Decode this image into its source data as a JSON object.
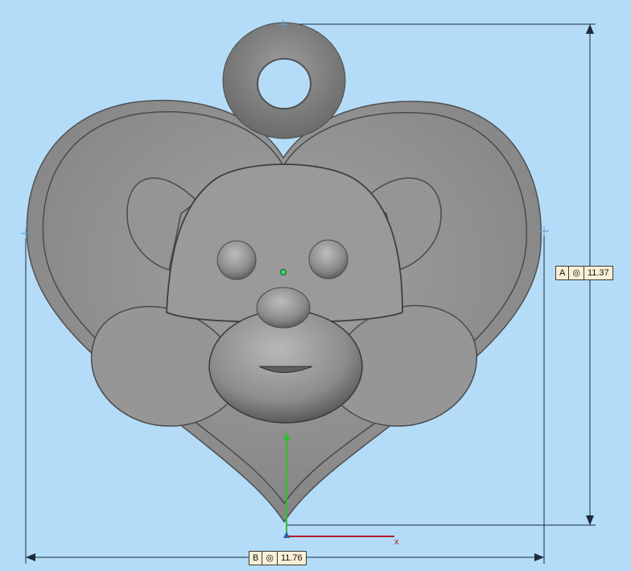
{
  "dimensions": {
    "height": {
      "letter": "A",
      "symbol": "◎",
      "value": "11.37"
    },
    "width": {
      "letter": "B",
      "symbol": "◎",
      "value": "11.76"
    }
  },
  "axes": {
    "x_label": "x"
  },
  "colors": {
    "background": "#b4dcf8",
    "model": "#8f8f8f",
    "axis_x": "#b01c2a",
    "axis_y": "#2fbf2f"
  }
}
